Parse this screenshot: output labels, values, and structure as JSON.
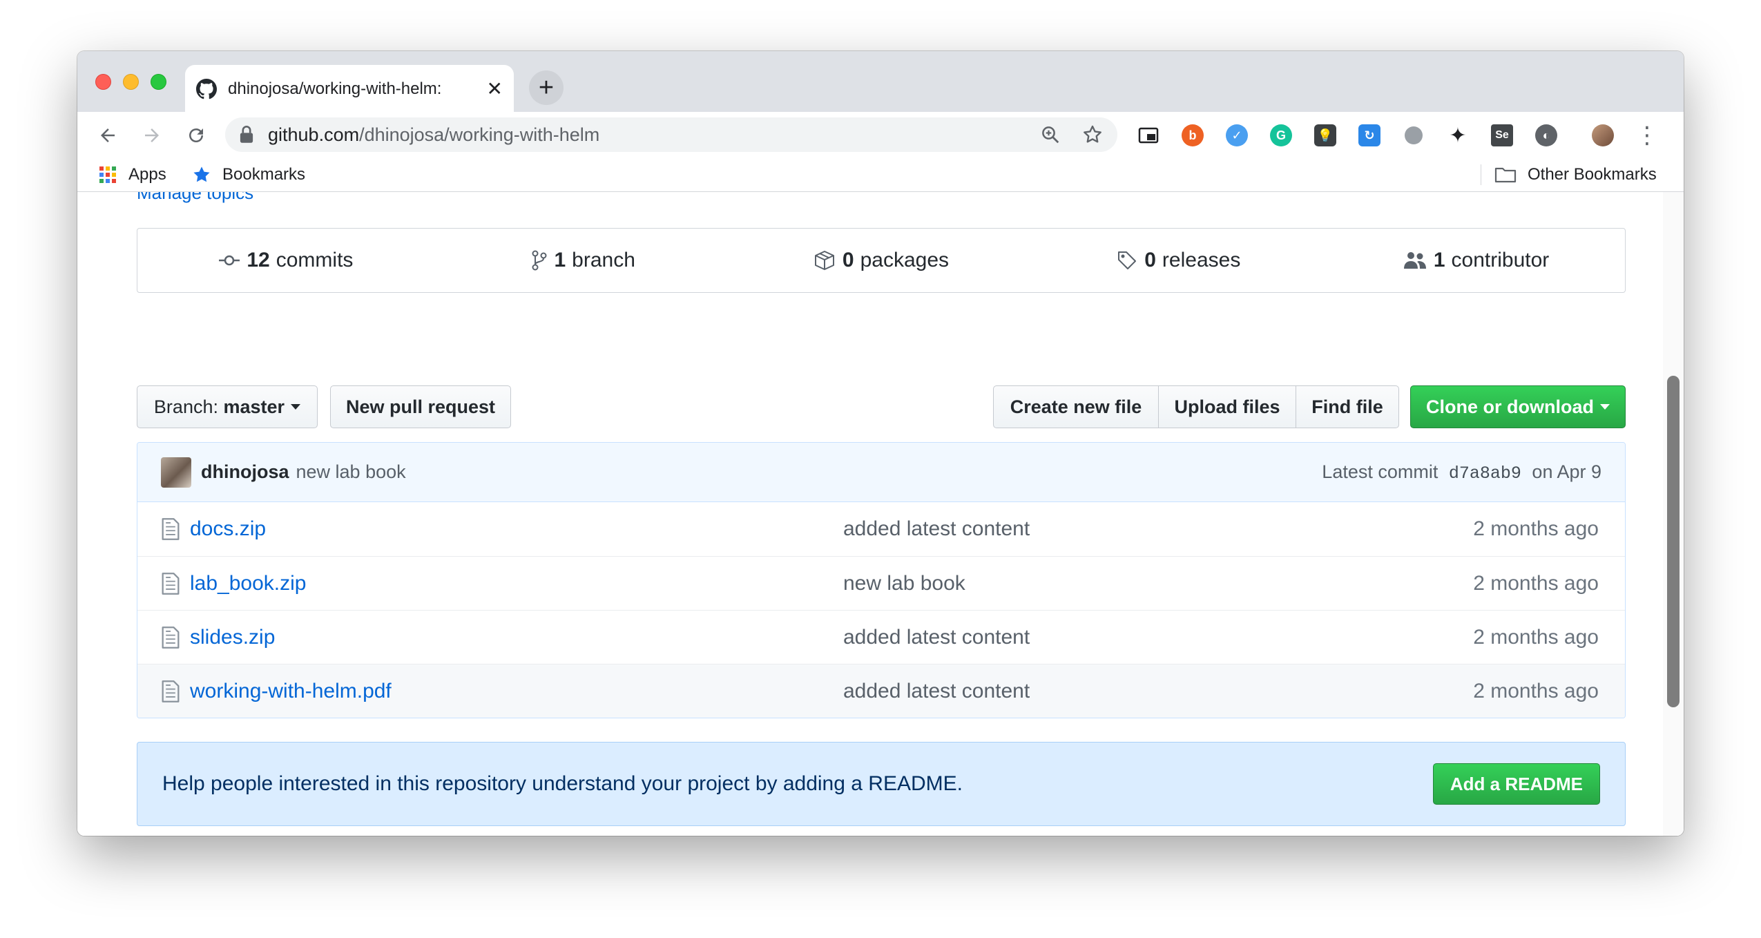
{
  "browser": {
    "tab_title": "dhinojosa/working-with-helm: ",
    "url_host": "github.com",
    "url_path": "/dhinojosa/working-with-helm",
    "bookmarks": {
      "apps": "Apps",
      "bookmarks": "Bookmarks",
      "other": "Other Bookmarks"
    }
  },
  "repo": {
    "manage_topics": "Manage topics",
    "stats": {
      "commits_count": "12",
      "commits_label": "commits",
      "branch_count": "1",
      "branch_label": "branch",
      "packages_count": "0",
      "packages_label": "packages",
      "releases_count": "0",
      "releases_label": "releases",
      "contributor_count": "1",
      "contributor_label": "contributor"
    },
    "branch_prefix": "Branch:",
    "branch_name": "master",
    "new_pull_request": "New pull request",
    "create_new_file": "Create new file",
    "upload_files": "Upload files",
    "find_file": "Find file",
    "clone_download": "Clone or download",
    "latest_commit": {
      "author": "dhinojosa",
      "message": "new lab book",
      "prefix": "Latest commit",
      "sha": "d7a8ab9",
      "date": "on Apr 9"
    },
    "files": [
      {
        "name": "docs.zip",
        "message": "added latest content",
        "age": "2 months ago"
      },
      {
        "name": "lab_book.zip",
        "message": "new lab book",
        "age": "2 months ago"
      },
      {
        "name": "slides.zip",
        "message": "added latest content",
        "age": "2 months ago"
      },
      {
        "name": "working-with-helm.pdf",
        "message": "added latest content",
        "age": "2 months ago"
      }
    ],
    "readme_prompt": "Help people interested in this repository understand your project by adding a README.",
    "add_readme": "Add a README"
  },
  "colors": {
    "link": "#0366d6",
    "green_button": "#28a745",
    "readme_banner": "#dbedff"
  }
}
